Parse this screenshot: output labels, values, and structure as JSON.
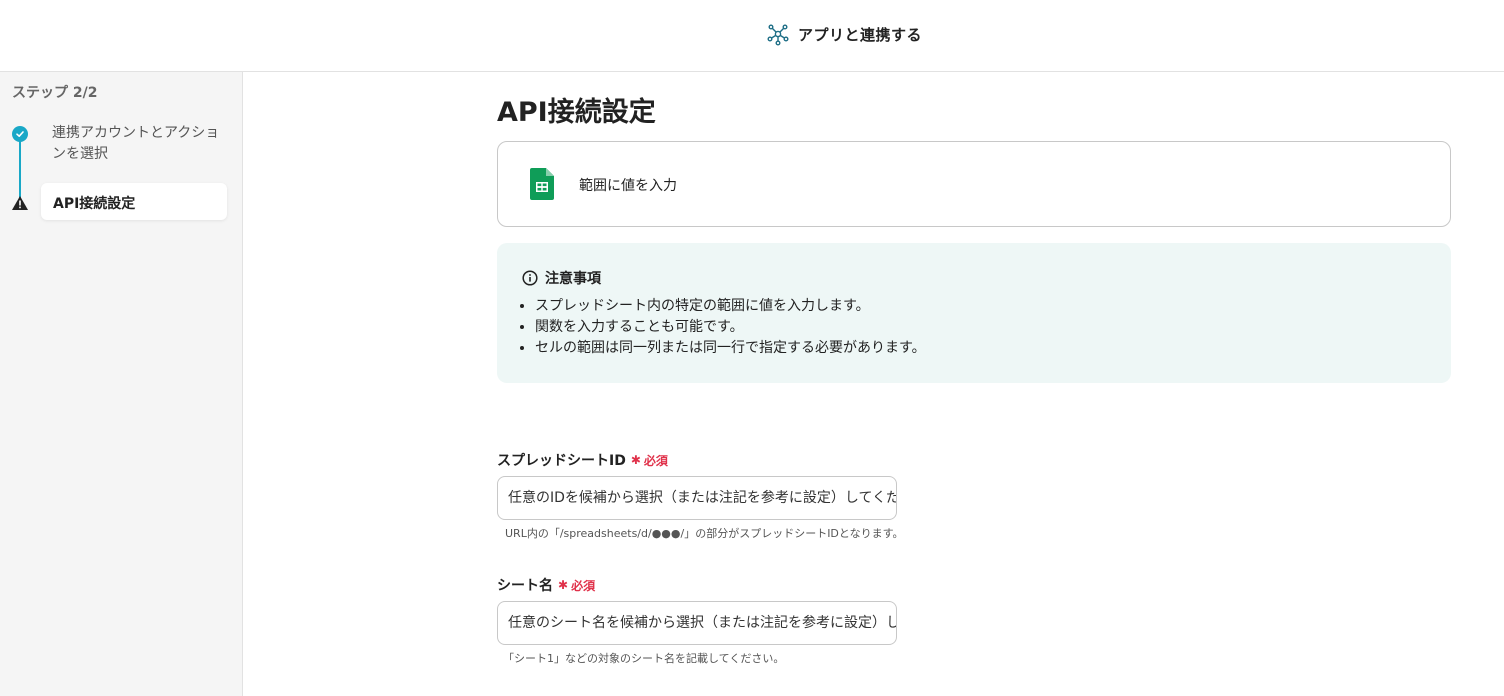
{
  "header": {
    "title": "アプリと連携する",
    "icon": "network-icon"
  },
  "sidebar": {
    "step_label": "ステップ 2/2",
    "steps": [
      {
        "label": "連携アカウントとアクションを選択",
        "status": "done"
      },
      {
        "label": "API接続設定",
        "status": "current-warning"
      }
    ]
  },
  "main": {
    "title": "API接続設定",
    "action": {
      "label": "範囲に値を入力",
      "icon": "google-sheets-icon"
    },
    "notice": {
      "title": "注意事項",
      "items": [
        "スプレッドシート内の特定の範囲に値を入力します。",
        "関数を入力することも可能です。",
        "セルの範囲は同一列または同一行で指定する必要があります。"
      ]
    },
    "fields": [
      {
        "label": "スプレッドシートID",
        "required": "必須",
        "placeholder": "任意のIDを候補から選択（または注記を参考に設定）してください",
        "hint": "URL内の「/spreadsheets/d/●●●/」の部分がスプレッドシートIDとなります。"
      },
      {
        "label": "シート名",
        "required": "必須",
        "placeholder": "任意のシート名を候補から選択（または注記を参考に設定）してください",
        "hint": "「シート1」などの対象のシート名を記載してください。"
      }
    ]
  },
  "colors": {
    "accent": "#19a8c7",
    "required": "#e0314a",
    "notice_bg": "#eef7f6",
    "sheets_green": "#0f9d58"
  }
}
